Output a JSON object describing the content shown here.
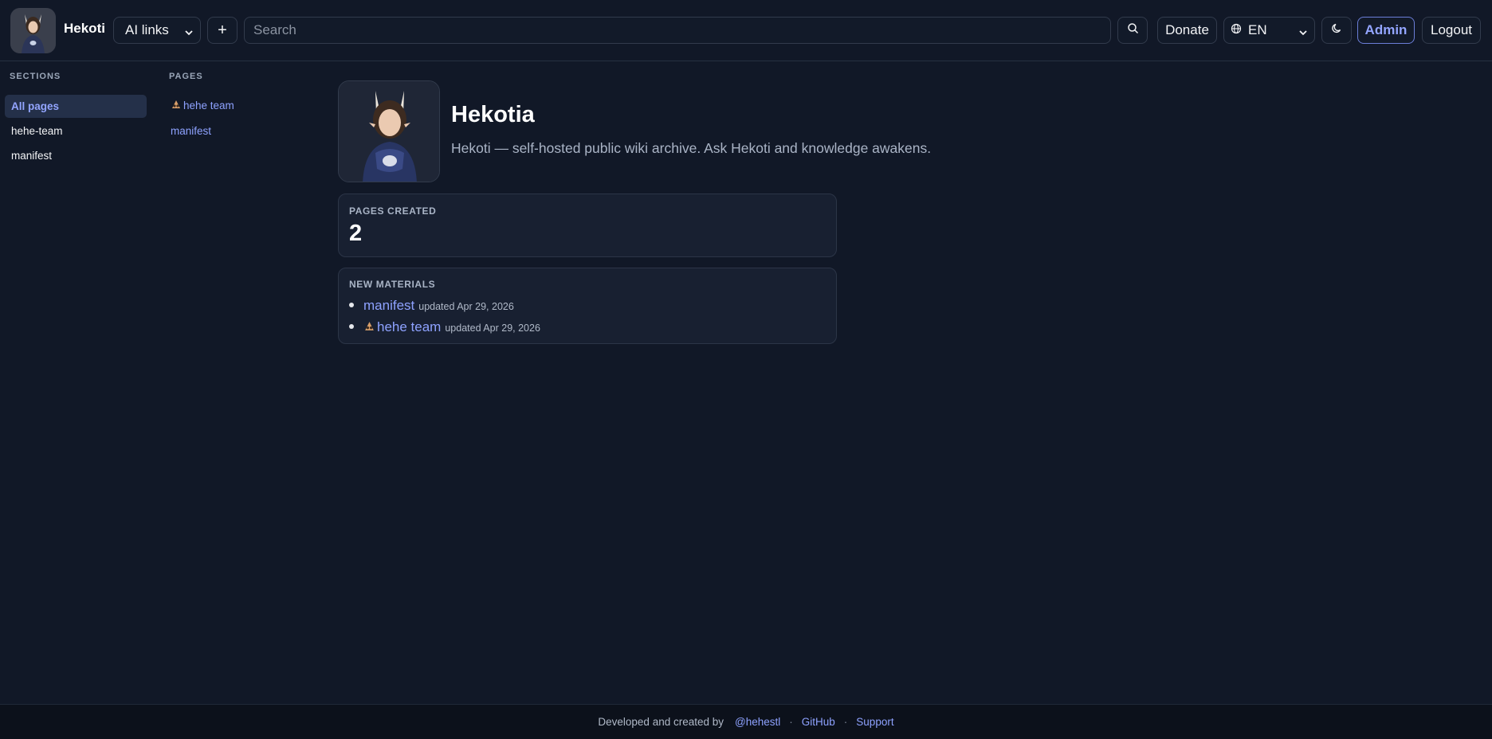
{
  "header": {
    "brand": "Hekoti",
    "ai_select_value": "AI links",
    "add_label": "+",
    "search_placeholder": "Search",
    "donate_label": "Donate",
    "language_value": "EN",
    "admin_label": "Admin",
    "logout_label": "Logout",
    "icons": [
      "logo-avatar",
      "chevron-down-icon",
      "plus-icon",
      "search-icon",
      "globe-icon",
      "moon-icon"
    ]
  },
  "sections": {
    "heading": "SECTIONS",
    "items": [
      {
        "label": "All pages",
        "active": true
      },
      {
        "label": "hehe-team",
        "active": false
      },
      {
        "label": "manifest",
        "active": false
      }
    ]
  },
  "pages": {
    "heading": "PAGES",
    "items": [
      {
        "label": "hehe team",
        "icon": "team-icon"
      },
      {
        "label": "manifest"
      }
    ]
  },
  "hero": {
    "title": "Hekotia",
    "description": "Hekoti — self-hosted public wiki archive. Ask Hekoti and knowledge awakens."
  },
  "stats": {
    "label": "PAGES CREATED",
    "value": "2"
  },
  "materials": {
    "label": "NEW MATERIALS",
    "items": [
      {
        "title": "manifest",
        "meta": "updated Apr 29, 2026"
      },
      {
        "title": "hehe team",
        "meta": "updated Apr 29, 2026",
        "icon": "team-icon"
      }
    ]
  },
  "footer": {
    "text": "Developed and created by",
    "author": "@hehestl",
    "github": "GitHub",
    "support": "Support",
    "separator": "·"
  },
  "colors": {
    "background": "#111827",
    "accent": "#8ea2ff",
    "card": "#182031"
  }
}
